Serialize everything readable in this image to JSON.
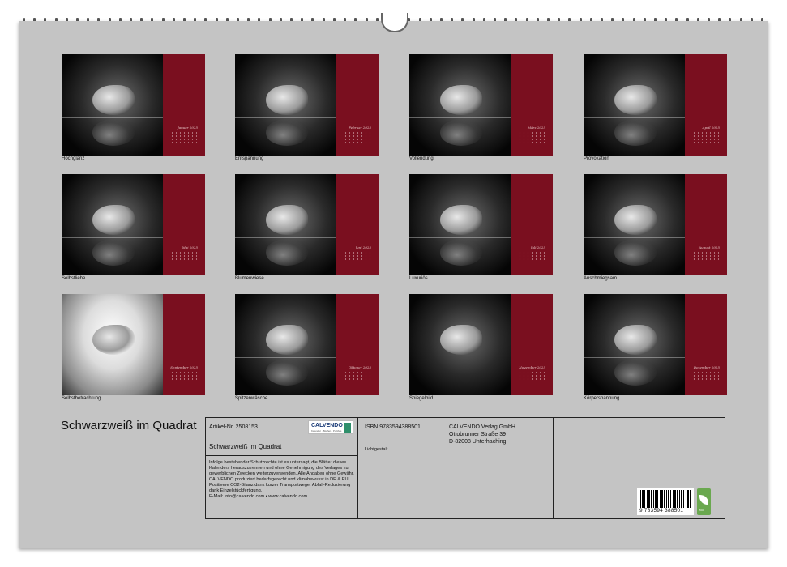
{
  "calendar": {
    "title": "Schwarzweiß im Quadrat",
    "months": [
      {
        "caption": "Hochglanz",
        "month": "Januar 2025"
      },
      {
        "caption": "Entspannung",
        "month": "Februar 2025"
      },
      {
        "caption": "Vollendung",
        "month": "März 2025"
      },
      {
        "caption": "Provokation",
        "month": "April 2025"
      },
      {
        "caption": "Selbstliebe",
        "month": "Mai 2025"
      },
      {
        "caption": "Blumenwiese",
        "month": "Juni 2025"
      },
      {
        "caption": "Luxuriös",
        "month": "Juli 2025"
      },
      {
        "caption": "Anschmiegsam",
        "month": "August 2025"
      },
      {
        "caption": "Selbstbetrachtung",
        "month": "September 2025"
      },
      {
        "caption": "Spitzenwäsche",
        "month": "Oktober 2025"
      },
      {
        "caption": "Spiegelbild",
        "month": "November 2025"
      },
      {
        "caption": "Körperspannung",
        "month": "Dezember 2025"
      }
    ]
  },
  "info": {
    "article": "Artikel-Nr. 2508153",
    "product_title": "Schwarzweiß im Quadrat",
    "notice": "Infolge bestehender Schutzrechte ist es untersagt, die Blätter dieses Kalenders herauszutrennen und ohne Genehmigung des Verlages zu gewerblichen Zwecken weiterzuverwenden. Alle Angaben ohne Gewähr. CALVENDO produziert bedarfsgerecht und klimabewusst in DE & EU. Positivere CO2-Bilanz dank kurzer Transportwege. Abfall-Reduzierung dank Einzelstückfertigung.",
    "contact": "E-Mail: info@calvendo.com • www.calvendo.com",
    "isbn": "ISBN 9783594388501",
    "author": "Lichtgestalt",
    "publisher_name": "CALVENDO Verlag GmbH",
    "publisher_street": "Ottobrunner Straße 39",
    "publisher_city": "D-82008 Unterhaching",
    "logo_word": "CALVENDO",
    "logo_tag": "Kalender · Bücher · Puzzles",
    "barcode_number": "9 783594 388501",
    "eco_label": "eco"
  },
  "colors": {
    "sheet": "#c4c4c4",
    "accent_red": "#7a0f1f"
  }
}
